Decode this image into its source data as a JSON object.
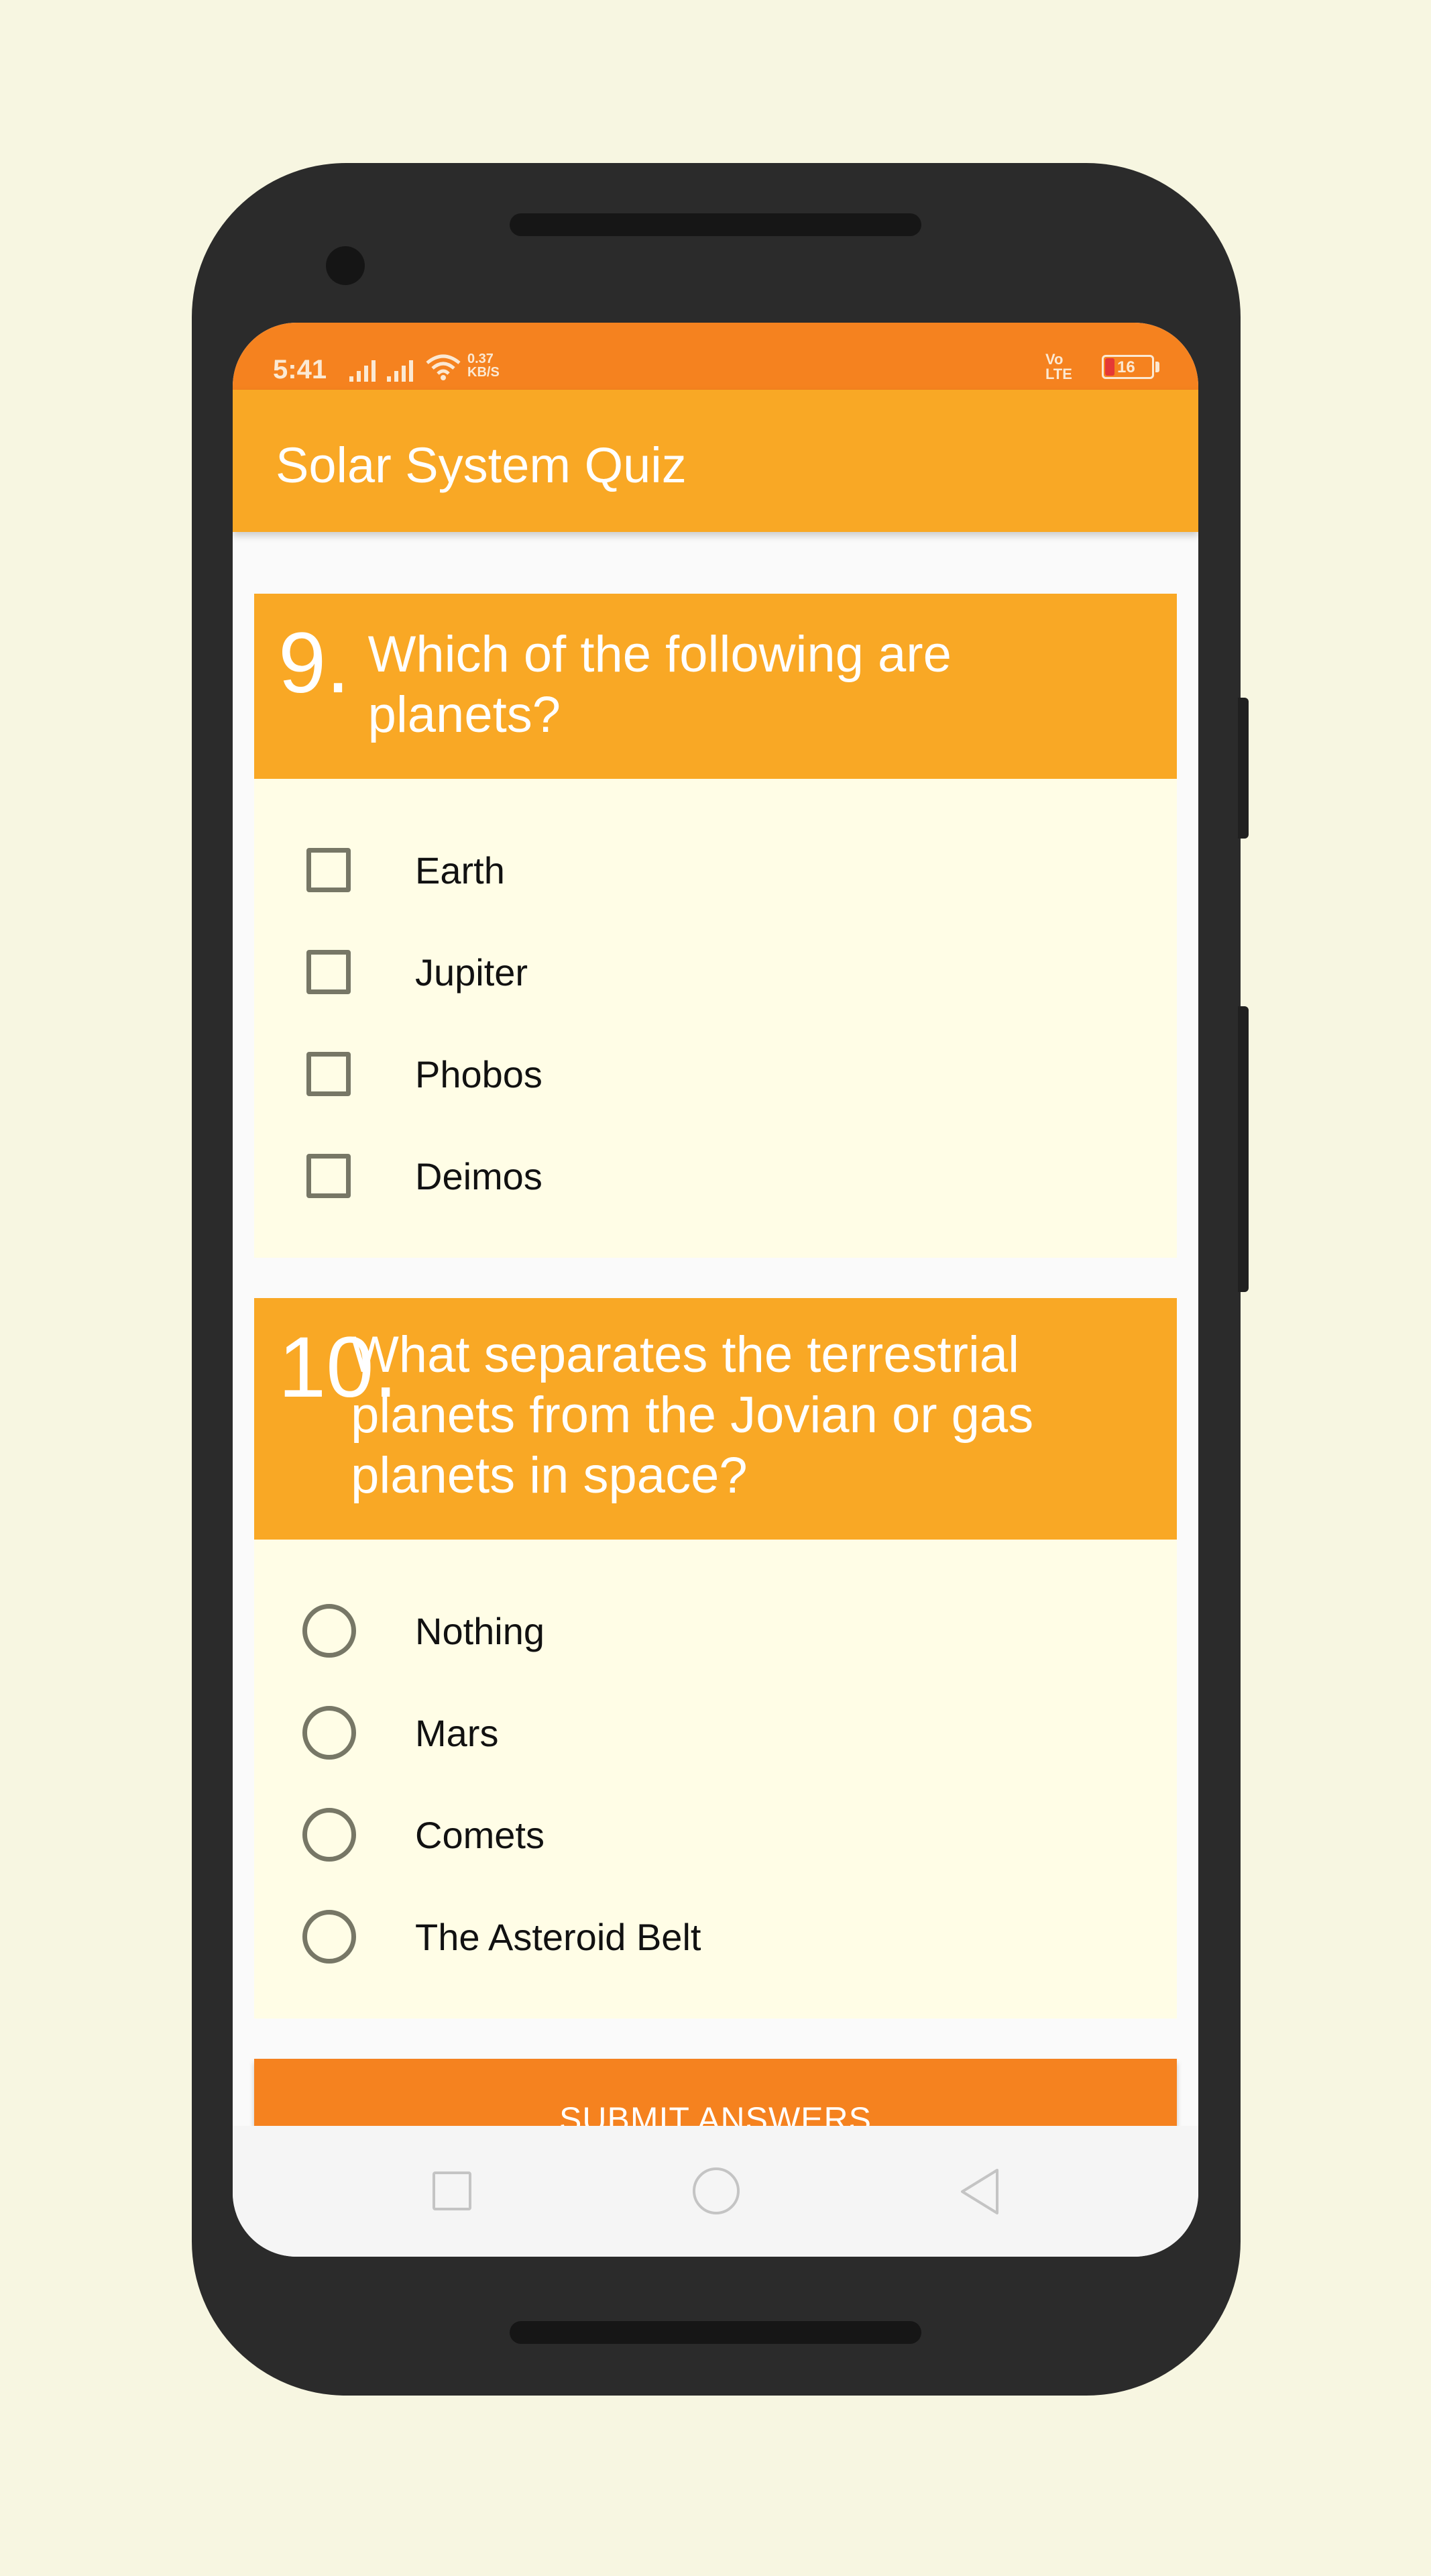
{
  "status_bar": {
    "time": "5:41",
    "speed_value": "0.37",
    "speed_unit": "KB/S",
    "volte_top": "Vo",
    "volte_bottom": "LTE",
    "battery": "16",
    "icons": [
      "signal-icon",
      "signal-icon",
      "wifi-icon",
      "volte-icon",
      "battery-icon"
    ]
  },
  "app_bar": {
    "title": "Solar System Quiz"
  },
  "questions": [
    {
      "number": "9.",
      "text": "Which of the following are planets?",
      "input_type": "checkbox",
      "options": [
        "Earth",
        "Jupiter",
        "Phobos",
        "Deimos"
      ]
    },
    {
      "number": "10.",
      "text": "What separates the terrestrial planets from the Jovian or gas planets in space?",
      "input_type": "radio",
      "options": [
        "Nothing",
        "Mars",
        "Comets",
        "The Asteroid Belt"
      ]
    }
  ],
  "submit_label": "SUBMIT ANSWERS",
  "nav_bar": {
    "icons": [
      "recents-icon",
      "home-icon",
      "back-icon"
    ]
  },
  "colors": {
    "background": "#f7f6e1",
    "status_bar": "#f5821f",
    "app_bar": "#f9a825",
    "card": "#fffde6",
    "submit": "#f5821f"
  }
}
